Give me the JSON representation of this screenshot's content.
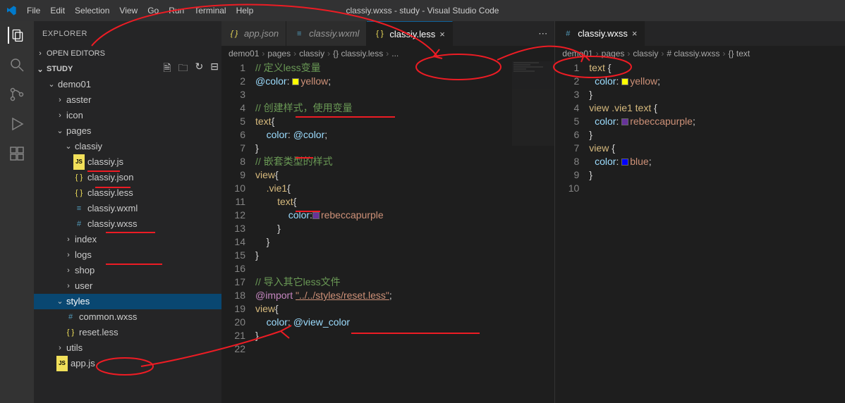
{
  "titlebar": {
    "menus": [
      "File",
      "Edit",
      "Selection",
      "View",
      "Go",
      "Run",
      "Terminal",
      "Help"
    ],
    "title": "classiy.wxss - study - Visual Studio Code"
  },
  "sidebar": {
    "title": "EXPLORER",
    "openEditors": "OPEN EDITORS",
    "project": "STUDY"
  },
  "tree": [
    {
      "t": "f",
      "d": 1,
      "l": "demo01",
      "open": true
    },
    {
      "t": "f",
      "d": 2,
      "l": "asster"
    },
    {
      "t": "f",
      "d": 2,
      "l": "icon"
    },
    {
      "t": "f",
      "d": 2,
      "l": "pages",
      "open": true
    },
    {
      "t": "f",
      "d": 3,
      "l": "classiy",
      "open": true
    },
    {
      "t": "i",
      "d": 4,
      "l": "classiy.js",
      "ic": "JS",
      "cls": "fi-js"
    },
    {
      "t": "i",
      "d": 4,
      "l": "classiy.json",
      "ic": "{ }",
      "cls": "fi-json"
    },
    {
      "t": "i",
      "d": 4,
      "l": "classiy.less",
      "ic": "{ }",
      "cls": "fi-less"
    },
    {
      "t": "i",
      "d": 4,
      "l": "classiy.wxml",
      "ic": "≡",
      "cls": "fi-wxml"
    },
    {
      "t": "i",
      "d": 4,
      "l": "classiy.wxss",
      "ic": "#",
      "cls": "fi-wxss"
    },
    {
      "t": "f",
      "d": 3,
      "l": "index"
    },
    {
      "t": "f",
      "d": 3,
      "l": "logs"
    },
    {
      "t": "f",
      "d": 3,
      "l": "shop"
    },
    {
      "t": "f",
      "d": 3,
      "l": "user"
    },
    {
      "t": "f",
      "d": 2,
      "l": "styles",
      "open": true,
      "sel": true
    },
    {
      "t": "i",
      "d": 3,
      "l": "common.wxss",
      "ic": "#",
      "cls": "fi-wxss"
    },
    {
      "t": "i",
      "d": 3,
      "l": "reset.less",
      "ic": "{ }",
      "cls": "fi-less"
    },
    {
      "t": "f",
      "d": 2,
      "l": "utils"
    },
    {
      "t": "i",
      "d": 2,
      "l": "app.js",
      "ic": "JS",
      "cls": "fi-js"
    }
  ],
  "left": {
    "tabs": [
      {
        "label": "app.json",
        "ic": "{ }",
        "cls": "fi-json",
        "italic": true
      },
      {
        "label": "classiy.wxml",
        "ic": "≡",
        "cls": "fi-wxml",
        "italic": true
      },
      {
        "label": "classiy.less",
        "ic": "{ }",
        "cls": "fi-less",
        "active": true,
        "dirty": true
      }
    ],
    "crumbs": [
      "demo01",
      "pages",
      "classiy",
      "{} classiy.less",
      "..."
    ],
    "code": [
      {
        "n": 1,
        "h": "<span class='tok-comment'>// 定义less变量</span>"
      },
      {
        "n": 2,
        "h": "<span class='tok-var'>@color</span><span class='tok-punct'>: </span><span class='swatch' style='background:#ffff00'></span><span class='tok-val'>yellow</span><span class='tok-punct'>;</span>"
      },
      {
        "n": 3,
        "h": ""
      },
      {
        "n": 4,
        "h": "<span class='tok-comment'>// 创建样式，使用变量</span>"
      },
      {
        "n": 5,
        "h": "<span class='tok-sel'>text</span><span class='tok-punct'>{</span>"
      },
      {
        "n": 6,
        "h": "    <span class='tok-prop'>color</span><span class='tok-punct'>: </span><span class='tok-var'>@color</span><span class='tok-punct'>;</span>"
      },
      {
        "n": 7,
        "h": "<span class='tok-punct'>}</span>"
      },
      {
        "n": 8,
        "h": "<span class='tok-comment'>// 嵌套类型的样式</span>"
      },
      {
        "n": 9,
        "h": "<span class='tok-sel'>view</span><span class='tok-punct'>{</span>"
      },
      {
        "n": 10,
        "h": "    <span class='tok-sel'>.vie1</span><span class='tok-punct'>{</span>"
      },
      {
        "n": 11,
        "h": "        <span class='tok-sel'>text</span><span class='tok-punct'>{</span>"
      },
      {
        "n": 12,
        "h": "            <span class='tok-prop'>color</span><span class='tok-punct'>:</span><span class='swatch' style='background:#663399'></span><span class='tok-val'>rebeccapurple</span>"
      },
      {
        "n": 13,
        "h": "        <span class='tok-punct'>}</span>"
      },
      {
        "n": 14,
        "h": "    <span class='tok-punct'>}</span>"
      },
      {
        "n": 15,
        "h": "<span class='tok-punct'>}</span>"
      },
      {
        "n": 16,
        "h": ""
      },
      {
        "n": 17,
        "h": "<span class='tok-comment'>// 导入其它less文件</span>"
      },
      {
        "n": 18,
        "h": "<span class='tok-key'>@import</span> <span class='tok-val' style='text-decoration:underline'>\"../../styles/reset.less\"</span><span class='tok-punct'>;</span>"
      },
      {
        "n": 19,
        "h": "<span class='tok-sel'>view</span><span class='tok-punct'>{</span>"
      },
      {
        "n": 20,
        "h": "    <span class='tok-prop'>color</span><span class='tok-punct'>: </span><span class='tok-var'>@view_color</span>"
      },
      {
        "n": 21,
        "h": "<span class='tok-punct'>}</span>"
      },
      {
        "n": 22,
        "h": ""
      }
    ]
  },
  "right": {
    "tabs": [
      {
        "label": "classiy.wxss",
        "ic": "#",
        "cls": "fi-wxss",
        "active": true
      }
    ],
    "crumbs": [
      "demo01",
      "pages",
      "classiy",
      "# classiy.wxss",
      "{} text"
    ],
    "code": [
      {
        "n": 1,
        "h": "<span class='tok-sel'>text</span> <span class='tok-punct'>{</span>"
      },
      {
        "n": 2,
        "h": "  <span class='tok-prop'>color</span><span class='tok-punct'>: </span><span class='swatch' style='background:#ffff00'></span><span class='tok-val'>yellow</span><span class='tok-punct'>;</span>"
      },
      {
        "n": 3,
        "h": "<span class='tok-punct'>}</span>"
      },
      {
        "n": 4,
        "h": "<span class='tok-sel'>view .vie1 text</span> <span class='tok-punct'>{</span>"
      },
      {
        "n": 5,
        "h": "  <span class='tok-prop'>color</span><span class='tok-punct'>: </span><span class='swatch' style='background:#663399'></span><span class='tok-val'>rebeccapurple</span><span class='tok-punct'>;</span>"
      },
      {
        "n": 6,
        "h": "<span class='tok-punct'>}</span>"
      },
      {
        "n": 7,
        "h": "<span class='tok-sel'>view</span> <span class='tok-punct'>{</span>"
      },
      {
        "n": 8,
        "h": "  <span class='tok-prop'>color</span><span class='tok-punct'>: </span><span class='swatch' style='background:#0000ff'></span><span class='tok-val'>blue</span><span class='tok-punct'>;</span>"
      },
      {
        "n": 9,
        "h": "<span class='tok-punct'>}</span>"
      },
      {
        "n": 10,
        "h": ""
      }
    ]
  }
}
